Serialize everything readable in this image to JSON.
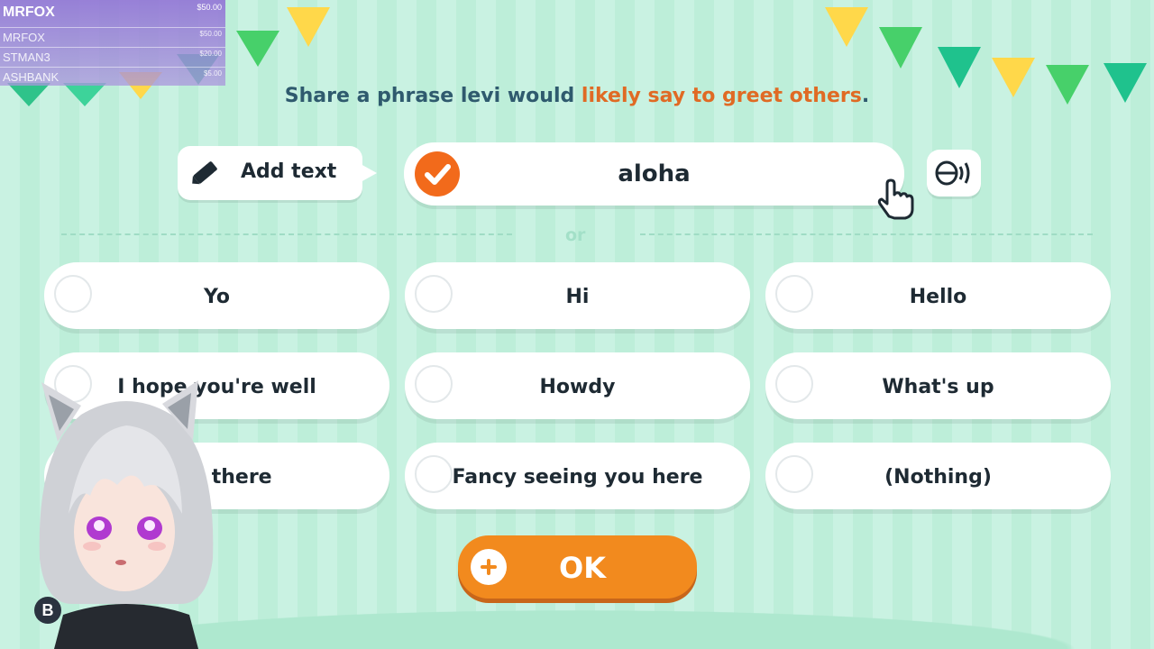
{
  "leaderboard": {
    "top_name": "MRFOX",
    "top_amount": "$50.00",
    "rows": [
      {
        "name": "MRFOX",
        "amount": "$50.00"
      },
      {
        "name": "STMAN3",
        "amount": "$20.00"
      },
      {
        "name": "ASHBANK",
        "amount": "$5.00"
      }
    ]
  },
  "prompt": {
    "prefix": "Share a phrase levi would",
    "highlight": "likely say to greet others",
    "suffix": "."
  },
  "add_text": {
    "label": "Add text"
  },
  "answer": {
    "text": "aloha"
  },
  "divider": {
    "or_label": "or"
  },
  "options": [
    {
      "label": "Yo"
    },
    {
      "label": "Hi"
    },
    {
      "label": "Hello"
    },
    {
      "label": "I hope you're well"
    },
    {
      "label": "Howdy"
    },
    {
      "label": "What's up"
    },
    {
      "label": "Hey there"
    },
    {
      "label": "Fancy seeing you here"
    },
    {
      "label": "(Nothing)"
    }
  ],
  "ok_button": {
    "label": "OK"
  },
  "controller_hint": {
    "button": "B"
  },
  "colors": {
    "accent_orange": "#f26a1b",
    "ok_orange": "#f28a1e",
    "prompt_text": "#2f5a6e",
    "background_mint": "#c9f2e2"
  },
  "icons": [
    "pencil-icon",
    "check-icon",
    "voice-icon",
    "hand-cursor-icon",
    "plus-icon"
  ]
}
